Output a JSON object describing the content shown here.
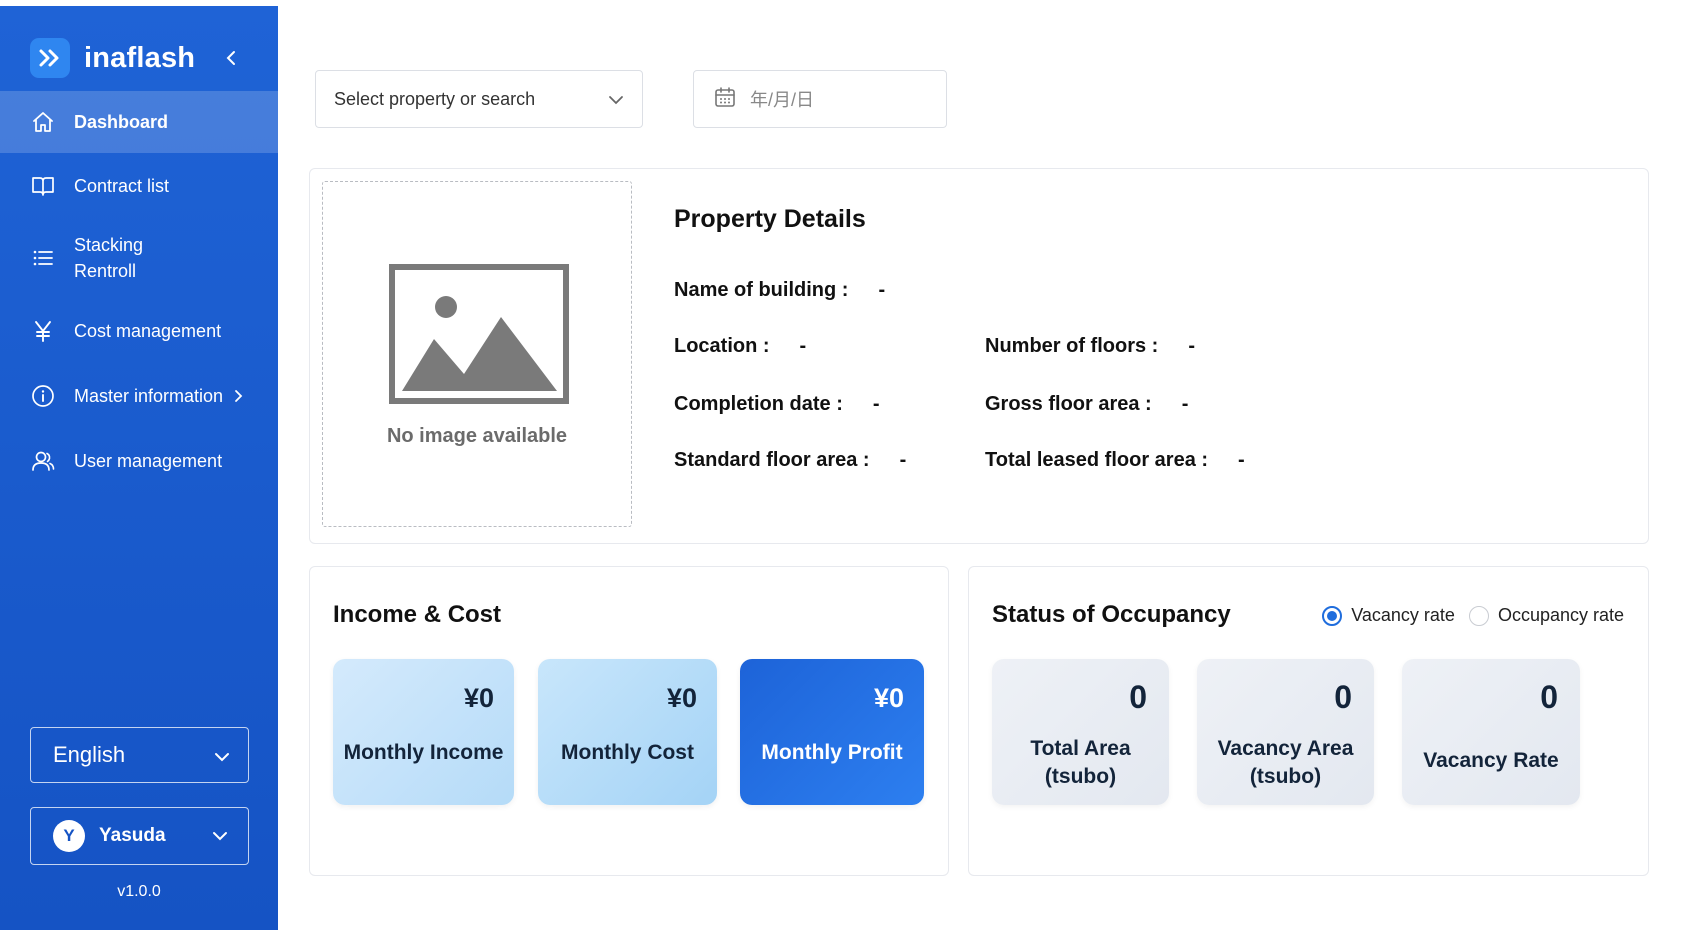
{
  "sidebar": {
    "brand": "inaflash",
    "nav": [
      {
        "label": "Dashboard",
        "icon": "home-icon"
      },
      {
        "label": "Contract list",
        "icon": "book-icon"
      },
      {
        "label": "Stacking\nRentroll",
        "icon": "list-icon"
      },
      {
        "label": "Cost management",
        "icon": "yen-icon"
      },
      {
        "label": "Master information",
        "icon": "info-icon"
      },
      {
        "label": "User management",
        "icon": "user-icon"
      }
    ],
    "language": "English",
    "user_initial": "Y",
    "user_name": "Yasuda",
    "version": "v1.0.0"
  },
  "filters": {
    "property_placeholder": "Select property or search",
    "date_placeholder": "年/月/日"
  },
  "property": {
    "image_caption": "No image available",
    "title": "Property Details",
    "fields": [
      {
        "label": "Name of building :",
        "value": "-"
      },
      {
        "label": "Location :",
        "value": "-"
      },
      {
        "label": "Number of floors :",
        "value": "-"
      },
      {
        "label": "Completion date :",
        "value": "-"
      },
      {
        "label": "Gross floor area :",
        "value": "-"
      },
      {
        "label": "Standard floor area :",
        "value": "-"
      },
      {
        "label": "Total leased floor area :",
        "value": "-"
      }
    ]
  },
  "income": {
    "title": "Income & Cost",
    "tiles": [
      {
        "amount": "¥0",
        "label": "Monthly Income"
      },
      {
        "amount": "¥0",
        "label": "Monthly Cost"
      },
      {
        "amount": "¥0",
        "label": "Monthly Profit"
      }
    ]
  },
  "occupancy": {
    "title": "Status of Occupancy",
    "radio_vacancy": "Vacancy rate",
    "radio_occupancy": "Occupancy rate",
    "selected": "vacancy",
    "tiles": [
      {
        "value": "0",
        "label": "Total Area\n(tsubo)"
      },
      {
        "value": "0",
        "label": "Vacancy Area\n(tsubo)"
      },
      {
        "value": "0",
        "label": "Vacancy Rate"
      }
    ]
  },
  "colors": {
    "sidebar": "#1f63d6",
    "accent": "#1f6ddd",
    "profit_tile": "#1d63d8"
  }
}
